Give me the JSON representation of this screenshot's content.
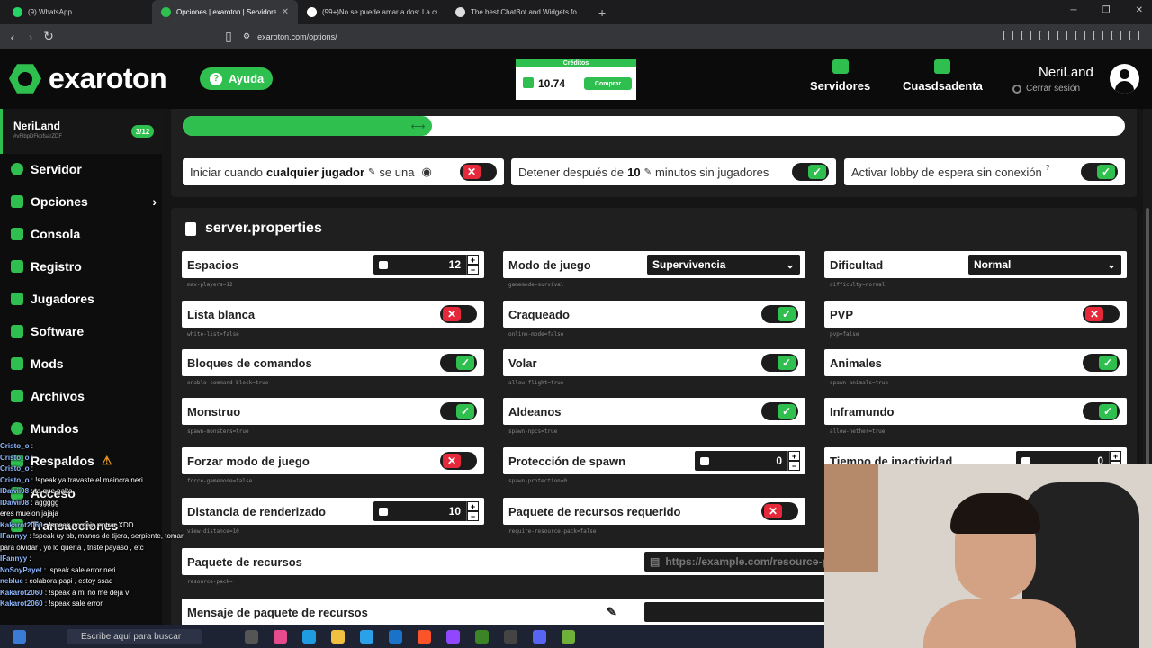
{
  "browser": {
    "tabs": [
      {
        "title": "(9) WhatsApp",
        "color": "#25d366",
        "active": false
      },
      {
        "title": "Opciones | exaroton | Servidores",
        "color": "#2fbf4e",
        "active": true
      },
      {
        "title": "(99+)No se puede amar a dos: La can",
        "color": "#ffffff",
        "active": false
      },
      {
        "title": "The best ChatBot and Widgets fo",
        "color": "#dddddd",
        "active": false
      }
    ],
    "new_tab": "+",
    "url": "exaroton.com/options/"
  },
  "header": {
    "logo": "exaroton",
    "help_label": "Ayuda",
    "credits_label": "Créditos",
    "credits_value": "10.74",
    "buy_label": "Comprar",
    "nav": [
      {
        "label": "Servidores",
        "icon": "server-icon"
      },
      {
        "label": "Cuasdsadenta",
        "icon": "account-icon"
      }
    ],
    "username": "NeriLand",
    "logout_label": "Cerrar sesión"
  },
  "sidebar": {
    "server_name": "NeriLand",
    "server_id": "#vFlbpDFkofsarZDF",
    "player_badge": "3/12",
    "items": [
      {
        "label": "Servidor",
        "icon": "power-icon"
      },
      {
        "label": "Opciones",
        "icon": "options-icon"
      },
      {
        "label": "Consola",
        "icon": "console-icon"
      },
      {
        "label": "Registro",
        "icon": "log-icon"
      },
      {
        "label": "Jugadores",
        "icon": "players-icon"
      },
      {
        "label": "Software",
        "icon": "software-icon"
      },
      {
        "label": "Mods",
        "icon": "puzzle-icon"
      },
      {
        "label": "Archivos",
        "icon": "folder-icon"
      },
      {
        "label": "Mundos",
        "icon": "globe-icon"
      },
      {
        "label": "Respaldos",
        "icon": "backup-icon"
      },
      {
        "label": "Acceso",
        "icon": "key-icon"
      },
      {
        "label": "Transacciones",
        "icon": "transactions-icon"
      }
    ]
  },
  "chat": [
    {
      "user": "Cristo_o",
      "msg": ":"
    },
    {
      "user": "Cristo_o",
      "msg": ":"
    },
    {
      "user": "Cristo_o",
      "msg": ":"
    },
    {
      "user": "Cristo_o",
      "msg": ": !speak ya travaste el maincra neri"
    },
    {
      "user": "lDawii08",
      "msg": ": ta que palta"
    },
    {
      "user": "lDawii08",
      "msg": ": aggggg"
    },
    {
      "user": "",
      "msg": "eres muelon jajaja"
    },
    {
      "user": "Kakarot2060",
      "msg": ": !speak no deja entrar XDD"
    },
    {
      "user": "IFannyy",
      "msg": ": !speak uy bb, manos de tijera, serpiente, tomar"
    },
    {
      "user": "",
      "msg": "para olvidar , yo lo quería , triste payaso , etc"
    },
    {
      "user": "IFannyy",
      "msg": ":"
    },
    {
      "user": "NoSoyPayet",
      "msg": ": !speak sale error neri"
    },
    {
      "user": "neblue",
      "msg": ": colabora papi , estoy ssad"
    },
    {
      "user": "Kakarot2060",
      "msg": ": !speak a mi no me deja v:"
    },
    {
      "user": "Kakarot2060",
      "msg": ": !speak sale error"
    }
  ],
  "main": {
    "progress_fraction": 0.265,
    "start_opt": {
      "prefix": "Iniciar cuando",
      "value": "cualquier jugador",
      "suffix": "se una",
      "state": "off"
    },
    "stop_opt": {
      "prefix": "Detener después de",
      "value": "10",
      "suffix": "minutos sin jugadores",
      "state": "on"
    },
    "lobby_opt": {
      "label": "Activar lobby de espera sin conexión",
      "info": "?",
      "state": "on"
    },
    "section_title": "server.properties",
    "props": [
      {
        "label": "Espacios",
        "key": "max-players=12",
        "type": "number",
        "value": "12",
        "icon": "players-icon"
      },
      {
        "label": "Modo de juego",
        "key": "gamemode=survival",
        "type": "select",
        "value": "Supervivencia"
      },
      {
        "label": "Dificultad",
        "key": "difficulty=normal",
        "type": "select",
        "value": "Normal"
      },
      {
        "label": "Lista blanca",
        "key": "white-list=false",
        "type": "toggle",
        "state": "off"
      },
      {
        "label": "Craqueado",
        "key": "online-mode=false",
        "type": "toggle",
        "state": "on"
      },
      {
        "label": "PVP",
        "key": "pvp=false",
        "type": "toggle",
        "state": "off"
      },
      {
        "label": "Bloques de comandos",
        "key": "enable-command-block=true",
        "type": "toggle",
        "state": "on"
      },
      {
        "label": "Volar",
        "key": "allow-flight=true",
        "type": "toggle",
        "state": "on"
      },
      {
        "label": "Animales",
        "key": "spawn-animals=true",
        "type": "toggle",
        "state": "on"
      },
      {
        "label": "Monstruo",
        "key": "spawn-monsters=true",
        "type": "toggle",
        "state": "on"
      },
      {
        "label": "Aldeanos",
        "key": "spawn-npcs=true",
        "type": "toggle",
        "state": "on"
      },
      {
        "label": "Inframundo",
        "key": "allow-nether=true",
        "type": "toggle",
        "state": "on"
      },
      {
        "label": "Forzar modo de juego",
        "key": "force-gamemode=false",
        "type": "toggle",
        "state": "off"
      },
      {
        "label": "Protección de spawn",
        "key": "spawn-protection=0",
        "type": "number",
        "value": "0",
        "icon": "shield-icon"
      },
      {
        "label": "Tiempo de inactividad",
        "key": "",
        "type": "number",
        "value": "0",
        "icon": "hourglass-icon"
      },
      {
        "label": "Distancia de renderizado",
        "key": "view-distance=10",
        "type": "number",
        "value": "10",
        "icon": "eye-icon"
      },
      {
        "label": "Paquete de recursos requerido",
        "key": "require-resource-pack=false",
        "type": "toggle",
        "state": "off"
      }
    ],
    "resource_pack": {
      "label": "Paquete de recursos",
      "key": "resource-pack=",
      "placeholder": "https://example.com/resource-p"
    },
    "resource_msg": {
      "label": "Mensaje de paquete de recursos"
    }
  },
  "taskbar": {
    "search_placeholder": "Escribe aquí para buscar"
  },
  "colors": {
    "accent": "#2fbf4e",
    "danger": "#e5283a"
  }
}
